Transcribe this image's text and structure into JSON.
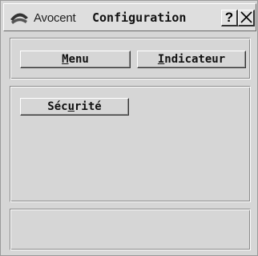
{
  "window": {
    "brand": "Avocent",
    "title": "Configuration",
    "help_label": "?"
  },
  "top_buttons": {
    "menu": {
      "mnemonic": "M",
      "rest": "enu"
    },
    "indicator": {
      "mnemonic": "I",
      "rest": "ndicateur"
    }
  },
  "main": {
    "security": {
      "before": "Séc",
      "mnemonic": "u",
      "after": "rité"
    }
  },
  "status": {
    "text": ""
  },
  "colors": {
    "window_bg": "#d6d6d6",
    "text": "#111111",
    "shadow": "#8a8a8a",
    "highlight": "#ffffff"
  },
  "icons": {
    "logo": "avocent-logo-icon",
    "help": "help-icon",
    "close": "close-icon"
  }
}
